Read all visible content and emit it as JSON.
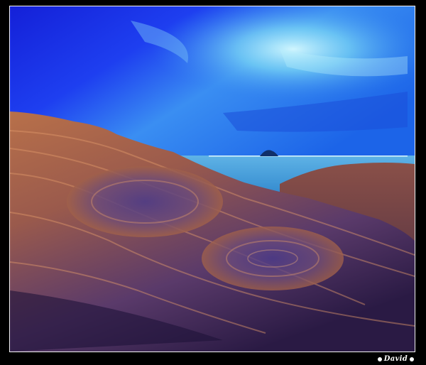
{
  "photo": {
    "subject": "sandstone-rocks-at-dusk",
    "colors": {
      "sky_deep": "#1a2fe0",
      "sky_light": "#8fe4f5",
      "sea": "#3e9bd6",
      "rock_warm": "#c47a4a",
      "rock_shadow": "#2a1b4a"
    }
  },
  "signature": {
    "text": "David"
  }
}
